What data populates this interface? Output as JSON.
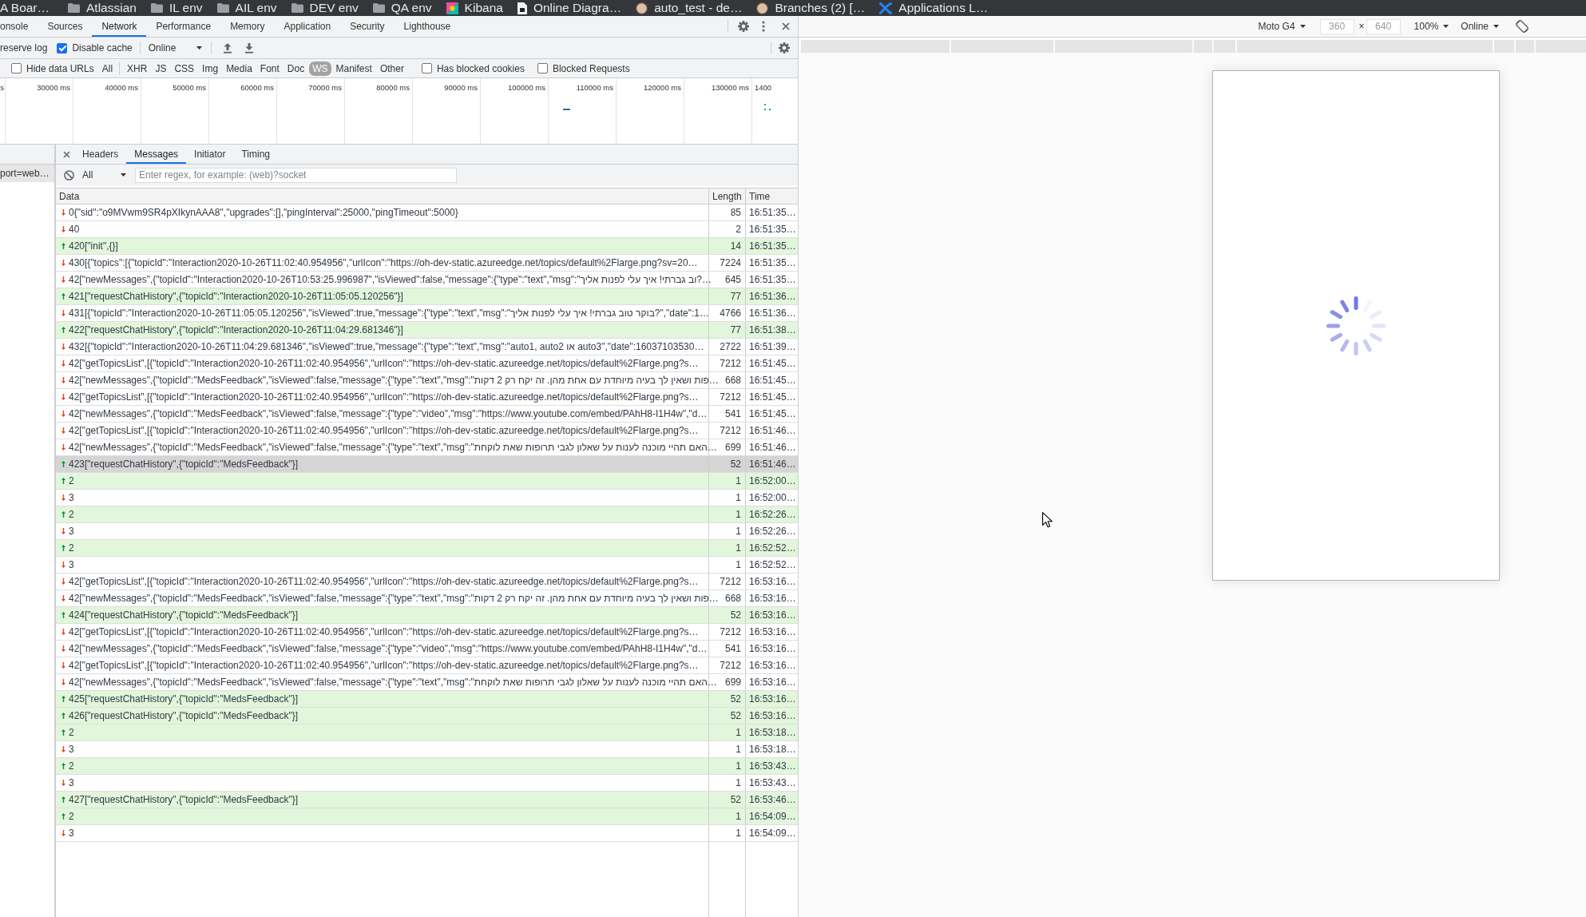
{
  "bookmarks_bar": {
    "items": [
      {
        "label": "A Boar…",
        "kind": "text"
      },
      {
        "label": "Atlassian",
        "kind": "folder"
      },
      {
        "label": "IL env",
        "kind": "folder"
      },
      {
        "label": "AIL env",
        "kind": "folder"
      },
      {
        "label": "DEV env",
        "kind": "folder"
      },
      {
        "label": "QA env",
        "kind": "folder"
      },
      {
        "label": "Kibana",
        "kind": "link"
      },
      {
        "label": "Online Diagra…",
        "kind": "link"
      },
      {
        "label": "auto_test - de…",
        "kind": "link"
      },
      {
        "label": "Branches (2) […",
        "kind": "link"
      },
      {
        "label": "Applications L…",
        "kind": "link"
      }
    ]
  },
  "devtools": {
    "panel_tabs": [
      {
        "label": "onsole",
        "selected": false
      },
      {
        "label": "Sources",
        "selected": false
      },
      {
        "label": "Network",
        "selected": true
      },
      {
        "label": "Performance",
        "selected": false
      },
      {
        "label": "Memory",
        "selected": false
      },
      {
        "label": "Application",
        "selected": false
      },
      {
        "label": "Security",
        "selected": false
      },
      {
        "label": "Lighthouse",
        "selected": false
      }
    ],
    "toolbar": {
      "preserve_log": {
        "label": "reserve log"
      },
      "disable_cache": {
        "label": "Disable cache",
        "checked": true
      },
      "throttling": "Online"
    },
    "filter_bar": {
      "hide_data_urls": {
        "label": "Hide data URLs",
        "checked": false
      },
      "all": {
        "label": "All",
        "selected": false
      },
      "types": [
        {
          "label": "XHR",
          "selected": false
        },
        {
          "label": "JS",
          "selected": false
        },
        {
          "label": "CSS",
          "selected": false
        },
        {
          "label": "Img",
          "selected": false
        },
        {
          "label": "Media",
          "selected": false
        },
        {
          "label": "Font",
          "selected": false
        },
        {
          "label": "Doc",
          "selected": false
        },
        {
          "label": "WS",
          "selected": true
        },
        {
          "label": "Manifest",
          "selected": false
        },
        {
          "label": "Other",
          "selected": false
        }
      ],
      "has_blocked_cookies": {
        "label": "Has blocked cookies",
        "checked": false
      },
      "blocked_requests": {
        "label": "Blocked Requests",
        "checked": false
      }
    },
    "overview": {
      "tick_labels": [
        "s",
        "30000 ms",
        "40000 ms",
        "50000 ms",
        "60000 ms",
        "70000 ms",
        "80000 ms",
        "90000 ms",
        "100000 ms",
        "110000 ms",
        "120000 ms",
        "130000 ms",
        "1400"
      ]
    },
    "requests": [
      {
        "name": "port=web…",
        "selected": true
      }
    ],
    "detail_tabs": [
      {
        "label": "Headers",
        "selected": false
      },
      {
        "label": "Messages",
        "selected": true
      },
      {
        "label": "Initiator",
        "selected": false
      },
      {
        "label": "Timing",
        "selected": false
      }
    ],
    "messages_filter": {
      "type": "All",
      "placeholder": "Enter regex, for example: (web)?socket"
    },
    "messages_table": {
      "columns": [
        "Data",
        "Length",
        "Time"
      ],
      "rows": [
        {
          "kind": "received",
          "data": "0{\"sid\":\"o9MVwm9SR4pXIkynAAA8\",\"upgrades\":[],\"pingInterval\":25000,\"pingTimeout\":5000}",
          "length": "85",
          "time": "16:51:35…",
          "selected": false
        },
        {
          "kind": "received",
          "data": "40",
          "length": "2",
          "time": "16:51:35…",
          "selected": false
        },
        {
          "kind": "sent",
          "data": "420[\"init\",{}]",
          "length": "14",
          "time": "16:51:35…",
          "selected": false
        },
        {
          "kind": "received",
          "data": "430[{\"topics\":[{\"topicId\":\"Interaction2020-10-26T11:02:40.954956\",\"urlIcon\":\"https://oh-dev-static.azureedge.net/topics/default%2Flarge.png?sv=20…",
          "length": "7224",
          "time": "16:51:35…",
          "selected": false
        },
        {
          "kind": "received",
          "data": "42[\"newMessages\",{\"topicId\":\"Interaction2020-10-26T10:53:25.996987\",\"isViewed\":false,\"message\":{\"type\":\"text\",\"msg\":\"וב גברתי! איך עלי לפנות אליך?…",
          "length": "645",
          "time": "16:51:35…",
          "selected": false
        },
        {
          "kind": "sent",
          "data": "421[\"requestChatHistory\",{\"topicId\":\"Interaction2020-10-26T11:05:05.120256\"}]",
          "length": "77",
          "time": "16:51:36…",
          "selected": false
        },
        {
          "kind": "received",
          "data": "431[{\"topicId\":\"Interaction2020-10-26T11:05:05.120256\",\"isViewed\":true,\"message\":{\"type\":\"text\",\"msg\":\"בוקר טוב גברתי! איך עלי לפנות אליך?\",\"date\":1…",
          "length": "4766",
          "time": "16:51:36…",
          "selected": false
        },
        {
          "kind": "sent",
          "data": "422[\"requestChatHistory\",{\"topicId\":\"Interaction2020-10-26T11:04:29.681346\"}]",
          "length": "77",
          "time": "16:51:38…",
          "selected": false
        },
        {
          "kind": "received",
          "data": "432[{\"topicId\":\"Interaction2020-10-26T11:04:29.681346\",\"isViewed\":true,\"message\":{\"type\":\"text\",\"msg\":\"auto1, auto2 או auto3\",\"date\":16037103530…",
          "length": "2722",
          "time": "16:51:39…",
          "selected": false
        },
        {
          "kind": "received",
          "data": "42[\"getTopicsList\",[{\"topicId\":\"Interaction2020-10-26T11:02:40.954956\",\"urlIcon\":\"https://oh-dev-static.azureedge.net/topics/default%2Flarge.png?s…",
          "length": "7212",
          "time": "16:51:45…",
          "selected": false
        },
        {
          "kind": "received",
          "data": "42[\"newMessages\",{\"topicId\":\"MedsFeedback\",\"isViewed\":false,\"message\":{\"type\":\"text\",\"msg\":\"פות ושאין לך בעיה מיוחדת עם אחת מהן. זה יקח רק 2 דקות…",
          "length": "668",
          "time": "16:51:45…",
          "selected": false
        },
        {
          "kind": "received",
          "data": "42[\"getTopicsList\",[{\"topicId\":\"Interaction2020-10-26T11:02:40.954956\",\"urlIcon\":\"https://oh-dev-static.azureedge.net/topics/default%2Flarge.png?s…",
          "length": "7212",
          "time": "16:51:45…",
          "selected": false
        },
        {
          "kind": "received",
          "data": "42[\"newMessages\",{\"topicId\":\"MedsFeedback\",\"isViewed\":false,\"message\":{\"type\":\"video\",\"msg\":\"https://www.youtube.com/embed/PAhH8-I1H4w\",\"d…",
          "length": "541",
          "time": "16:51:45…",
          "selected": false
        },
        {
          "kind": "received",
          "data": "42[\"getTopicsList\",[{\"topicId\":\"Interaction2020-10-26T11:02:40.954956\",\"urlIcon\":\"https://oh-dev-static.azureedge.net/topics/default%2Flarge.png?s…",
          "length": "7212",
          "time": "16:51:46…",
          "selected": false
        },
        {
          "kind": "received",
          "data": "42[\"newMessages\",{\"topicId\":\"MedsFeedback\",\"isViewed\":false,\"message\":{\"type\":\"text\",\"msg\":\"האם תהיי מוכנה לענות על שאלון לגבי תרופות שאת לוקחת…",
          "length": "699",
          "time": "16:51:46…",
          "selected": false
        },
        {
          "kind": "sent",
          "data": "423[\"requestChatHistory\",{\"topicId\":\"MedsFeedback\"}]",
          "length": "52",
          "time": "16:51:46…",
          "selected": true
        },
        {
          "kind": "sent",
          "data": "2",
          "length": "1",
          "time": "16:52:00…",
          "selected": false
        },
        {
          "kind": "received",
          "data": "3",
          "length": "1",
          "time": "16:52:00…",
          "selected": false
        },
        {
          "kind": "sent",
          "data": "2",
          "length": "1",
          "time": "16:52:26…",
          "selected": false
        },
        {
          "kind": "received",
          "data": "3",
          "length": "1",
          "time": "16:52:26…",
          "selected": false
        },
        {
          "kind": "sent",
          "data": "2",
          "length": "1",
          "time": "16:52:52…",
          "selected": false
        },
        {
          "kind": "received",
          "data": "3",
          "length": "1",
          "time": "16:52:52…",
          "selected": false
        },
        {
          "kind": "received",
          "data": "42[\"getTopicsList\",[{\"topicId\":\"Interaction2020-10-26T11:02:40.954956\",\"urlIcon\":\"https://oh-dev-static.azureedge.net/topics/default%2Flarge.png?s…",
          "length": "7212",
          "time": "16:53:16…",
          "selected": false
        },
        {
          "kind": "received",
          "data": "42[\"newMessages\",{\"topicId\":\"MedsFeedback\",\"isViewed\":false,\"message\":{\"type\":\"text\",\"msg\":\"פות ושאין לך בעיה מיוחדת עם אחת מהן. זה יקח רק 2 דקות…",
          "length": "668",
          "time": "16:53:16…",
          "selected": false
        },
        {
          "kind": "sent",
          "data": "424[\"requestChatHistory\",{\"topicId\":\"MedsFeedback\"}]",
          "length": "52",
          "time": "16:53:16…",
          "selected": false
        },
        {
          "kind": "received",
          "data": "42[\"getTopicsList\",[{\"topicId\":\"Interaction2020-10-26T11:02:40.954956\",\"urlIcon\":\"https://oh-dev-static.azureedge.net/topics/default%2Flarge.png?s…",
          "length": "7212",
          "time": "16:53:16…",
          "selected": false
        },
        {
          "kind": "received",
          "data": "42[\"newMessages\",{\"topicId\":\"MedsFeedback\",\"isViewed\":false,\"message\":{\"type\":\"video\",\"msg\":\"https://www.youtube.com/embed/PAhH8-I1H4w\",\"d…",
          "length": "541",
          "time": "16:53:16…",
          "selected": false
        },
        {
          "kind": "received",
          "data": "42[\"getTopicsList\",[{\"topicId\":\"Interaction2020-10-26T11:02:40.954956\",\"urlIcon\":\"https://oh-dev-static.azureedge.net/topics/default%2Flarge.png?s…",
          "length": "7212",
          "time": "16:53:16…",
          "selected": false
        },
        {
          "kind": "received",
          "data": "42[\"newMessages\",{\"topicId\":\"MedsFeedback\",\"isViewed\":false,\"message\":{\"type\":\"text\",\"msg\":\"האם תהיי מוכנה לענות על שאלון לגבי תרופות שאת לוקחת…",
          "length": "699",
          "time": "16:53:16…",
          "selected": false
        },
        {
          "kind": "sent",
          "data": "425[\"requestChatHistory\",{\"topicId\":\"MedsFeedback\"}]",
          "length": "52",
          "time": "16:53:16…",
          "selected": false
        },
        {
          "kind": "sent",
          "data": "426[\"requestChatHistory\",{\"topicId\":\"MedsFeedback\"}]",
          "length": "52",
          "time": "16:53:16…",
          "selected": false
        },
        {
          "kind": "sent",
          "data": "2",
          "length": "1",
          "time": "16:53:18…",
          "selected": false
        },
        {
          "kind": "received",
          "data": "3",
          "length": "1",
          "time": "16:53:18…",
          "selected": false
        },
        {
          "kind": "sent",
          "data": "2",
          "length": "1",
          "time": "16:53:43…",
          "selected": false
        },
        {
          "kind": "received",
          "data": "3",
          "length": "1",
          "time": "16:53:43…",
          "selected": false
        },
        {
          "kind": "sent",
          "data": "427[\"requestChatHistory\",{\"topicId\":\"MedsFeedback\"}]",
          "length": "52",
          "time": "16:53:46…",
          "selected": false
        },
        {
          "kind": "sent",
          "data": "2",
          "length": "1",
          "time": "16:54:09…",
          "selected": false
        },
        {
          "kind": "received",
          "data": "3",
          "length": "1",
          "time": "16:54:09…",
          "selected": false
        }
      ]
    }
  },
  "device_toolbar": {
    "device": "Moto G4",
    "width": {
      "value": "360",
      "disabled": true
    },
    "times": "×",
    "height": {
      "value": "640",
      "disabled": true
    },
    "zoom": "100%",
    "throttling": "Online"
  }
}
